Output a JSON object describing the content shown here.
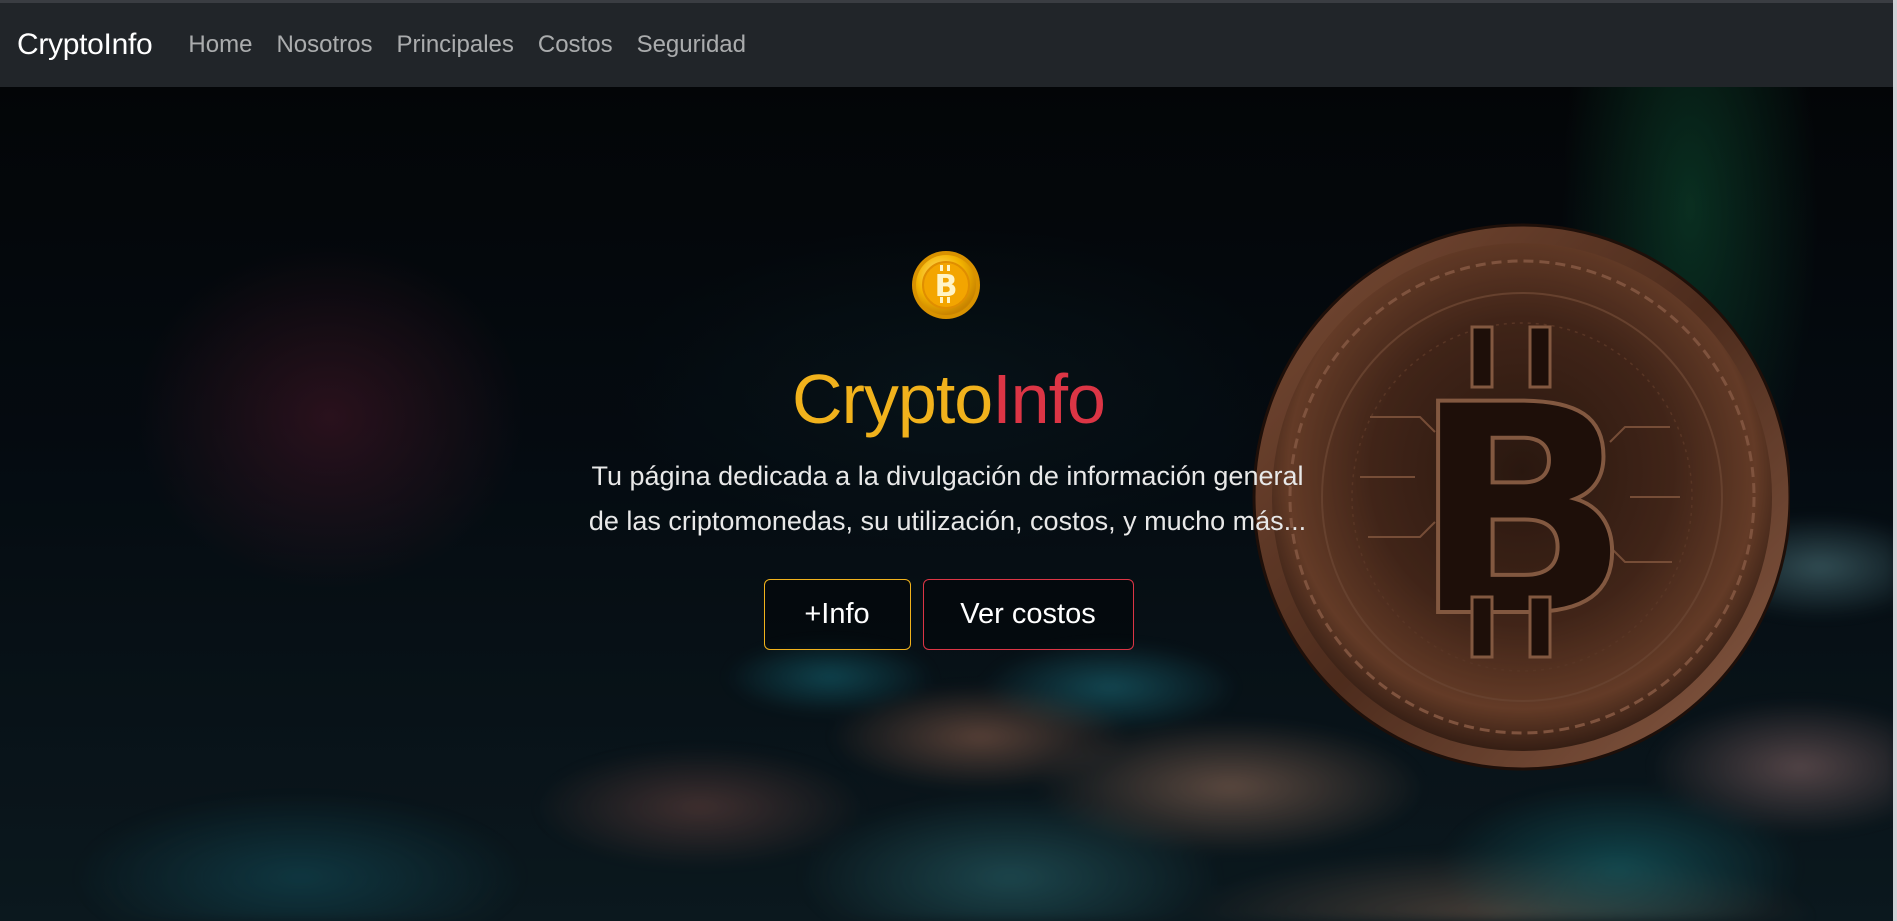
{
  "navbar": {
    "brand": "CryptoInfo",
    "links": [
      "Home",
      "Nosotros",
      "Principales",
      "Costos",
      "Seguridad"
    ]
  },
  "hero": {
    "logo_icon": "bitcoin-coin-icon",
    "title_part1": "Crypto",
    "title_part2": "Info",
    "text_line1": "Tu página dedicada a la divulgación de información general",
    "text_line2": "de las criptomonedas, su utilización, costos, y mucho más...",
    "button_info": "+Info",
    "button_costs": "Ver costos",
    "background_image": "bitcoin-coin-photo"
  },
  "colors": {
    "navbar_bg": "#212529",
    "accent_yellow": "#f1b21c",
    "accent_red": "#dc3545"
  }
}
